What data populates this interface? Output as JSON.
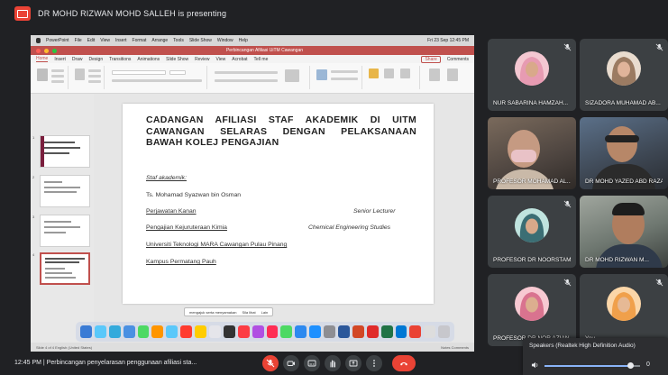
{
  "presenter": {
    "banner": "DR MOHD RIZWAN MOHD SALLEH is presenting"
  },
  "mac": {
    "menu": [
      "PowerPoint",
      "File",
      "Edit",
      "View",
      "Insert",
      "Format",
      "Arrange",
      "Tools",
      "Slide Show",
      "Window",
      "Help"
    ],
    "clock": "Fri 23 Sep 12:45 PM"
  },
  "ppt": {
    "doc_title": "Perbincangan Afiliasi UiTM Cawangan",
    "tabs": [
      "Home",
      "Insert",
      "Draw",
      "Design",
      "Transitions",
      "Animations",
      "Slide Show",
      "Review",
      "View",
      "Acrobat",
      "Tell me"
    ],
    "active_tab": 0,
    "share_label": "Share",
    "comments_label": "Comments",
    "status_left": "Slide 4 of 4   English (United States)",
    "status_right": "Notes   Comments",
    "zoom_tip": [
      "mengajuk serta menyamakan",
      "Sila lihat",
      "Lain"
    ]
  },
  "slide": {
    "title": "CADANGAN AFILIASI STAF AKADEMIK DI UiTM CAWANGAN SELARAS DENGAN PELAKSANAAN BAWAH KOLEJ PENGAJIAN",
    "section_label": "Staf akademik:",
    "name": "Ts. Mohamad Syazwan bin Osman",
    "position_label": "Perjawatan Kanan",
    "position_value": "Senior Lecturer",
    "faculty_label": "Pengajian Kejuruteraan Kimia",
    "faculty_value": "Chemical Engineering Studies",
    "university": "Universiti Teknologi MARA Cawangan Pulau Pinang",
    "campus": "Kampus Permatang Pauh"
  },
  "participants": [
    {
      "name": "NUR SABARINA HAMZAH...",
      "kind": "avatar-pink",
      "muted": true
    },
    {
      "name": "SIZADORA MUHAMAD AB...",
      "kind": "avatar-brown",
      "muted": true
    },
    {
      "name": "PROFESOR MOHAMAD AL...",
      "kind": "video",
      "muted": false
    },
    {
      "name": "DR MOHD YAZED ABD RAZAK",
      "kind": "video2",
      "muted": false
    },
    {
      "name": "PROFESOR DR NOORSTAM...",
      "kind": "avatar-teal",
      "muted": true
    },
    {
      "name": "DR MOHD RIZWAN M...",
      "kind": "video3",
      "muted": false
    },
    {
      "name": "PROFESOR DR NOR AZIAN...",
      "kind": "avatar-rose",
      "muted": true
    },
    {
      "name": "You",
      "kind": "avatar-orange",
      "muted": true
    }
  ],
  "meeting": {
    "info": "12:45 PM  |  Perbincangan penyelarasan penggunaan afiliasi sta..."
  },
  "speaker": {
    "label": "Speakers (Realtek High Definition Audio)",
    "volume": 0.9,
    "volume_value": "0"
  },
  "colors": {
    "accent": "#ea4335",
    "ppt_red": "#c0504d",
    "bg": "#202124"
  }
}
